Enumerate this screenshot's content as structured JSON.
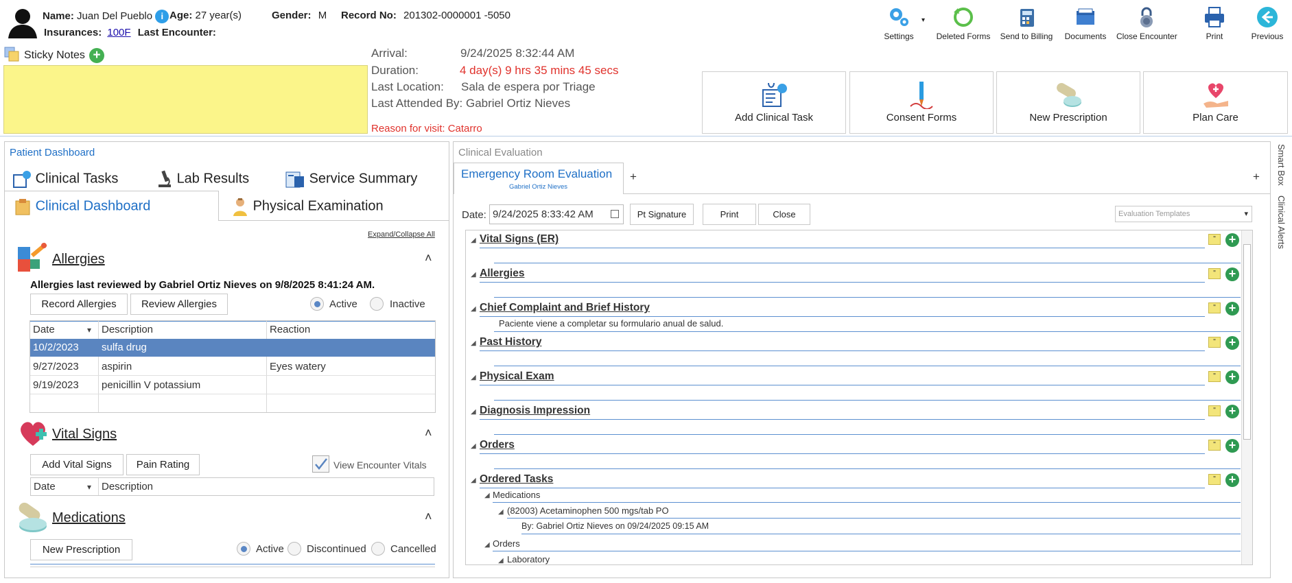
{
  "patient": {
    "name_label": "Name:",
    "name": "Juan Del Pueblo",
    "info_badge": "i",
    "age_label": "Age:",
    "age": "27 year(s)",
    "gender_label": "Gender:",
    "gender": "M",
    "record_label": "Record No:",
    "record": "201302-0000001 -5050",
    "insurances_label": "Insurances:",
    "insurance": "100F",
    "last_encounter_label": "Last Encounter:",
    "last_encounter": ""
  },
  "sticky": {
    "label": "Sticky Notes",
    "add": "+"
  },
  "encounter": {
    "arrival_label": "Arrival:",
    "arrival": "9/24/2025 8:32:44 AM",
    "duration_label": "Duration:",
    "duration": "4 day(s) 9 hrs 35 mins 45 secs",
    "location_label": "Last Location:",
    "location": "Sala de espera por Triage",
    "attended": "Last Attended By: Gabriel Ortiz Nieves",
    "reason": "Reason for visit: Catarro"
  },
  "toolbar": {
    "settings": "Settings",
    "settings_caret": "▾",
    "deleted": "Deleted Forms",
    "billing": "Send to Billing",
    "documents": "Documents",
    "close": "Close Encounter",
    "print": "Print",
    "previous": "Previous"
  },
  "actions": {
    "clinical_task": "Add Clinical Task",
    "consent": "Consent Forms",
    "prescription": "New Prescription",
    "plan": "Plan Care"
  },
  "dashboard": {
    "title": "Patient Dashboard",
    "tabs": [
      "Clinical Tasks",
      "Lab Results",
      "Service Summary",
      "Clinical Dashboard",
      "Physical Examination"
    ],
    "expand": "Expand/Collapse All",
    "collapse_glyph": "˄",
    "allergies": {
      "title": "Allergies",
      "reviewed": "Allergies last reviewed by Gabriel Ortiz Nieves on 9/8/2025 8:41:24 AM.",
      "record_btn": "Record Allergies",
      "review_btn": "Review Allergies",
      "active": "Active",
      "inactive": "Inactive",
      "columns": [
        "Date",
        "Description",
        "Reaction"
      ],
      "sort_glyph": "▾",
      "rows": [
        [
          "10/2/2023",
          "sulfa drug",
          ""
        ],
        [
          "9/27/2023",
          "aspirin",
          "Eyes watery"
        ],
        [
          "9/19/2023",
          "penicillin V potassium",
          ""
        ]
      ]
    },
    "vitals": {
      "title": "Vital Signs",
      "add_btn": "Add Vital Signs",
      "pain_btn": "Pain Rating",
      "view_label": "View Encounter Vitals",
      "columns": [
        "Date",
        "Description"
      ]
    },
    "medications": {
      "title": "Medications",
      "new_btn": "New Prescription",
      "active": "Active",
      "discontinued": "Discontinued",
      "cancelled": "Cancelled"
    }
  },
  "evaluation": {
    "title": "Clinical Evaluation",
    "tab": "Emergency Room Evaluation",
    "tab_sub": "Gabriel Ortiz Nieves",
    "add_tab": "+",
    "date_label": "Date:",
    "date": "9/24/2025 8:33:42 AM",
    "sig_btn": "Pt Signature",
    "print_btn": "Print",
    "close_btn": "Close",
    "templates": "Evaluation Templates",
    "quote_glyph": "\"",
    "plus_glyph": "+",
    "tri_glyph": "◢",
    "sections": [
      {
        "title": "Vital Signs (ER)",
        "text": ""
      },
      {
        "title": "Allergies",
        "text": ""
      },
      {
        "title": "Chief Complaint and Brief History",
        "text": "Paciente viene a completar su formulario anual de salud."
      },
      {
        "title": "Past History",
        "text": ""
      },
      {
        "title": "Physical Exam",
        "text": ""
      },
      {
        "title": "Diagnosis Impression",
        "text": ""
      },
      {
        "title": "Orders",
        "text": ""
      },
      {
        "title": "Ordered Tasks",
        "text": ""
      }
    ],
    "tasks": {
      "medications": "Medications",
      "med_item": "(82003) Acetaminophen 500 mgs/tab PO",
      "med_by": "By: Gabriel Ortiz Nieves on 09/24/2025 09:15 AM",
      "orders": "Orders",
      "laboratory": "Laboratory"
    }
  },
  "side": {
    "smart_box": "Smart Box",
    "alerts": "Clinical Alerts"
  },
  "colors": {
    "accent": "#1e6fc6",
    "red": "#e0322c",
    "sticky": "#fbf58a",
    "selected_row": "#5a85c0",
    "green": "#2f9a52"
  }
}
